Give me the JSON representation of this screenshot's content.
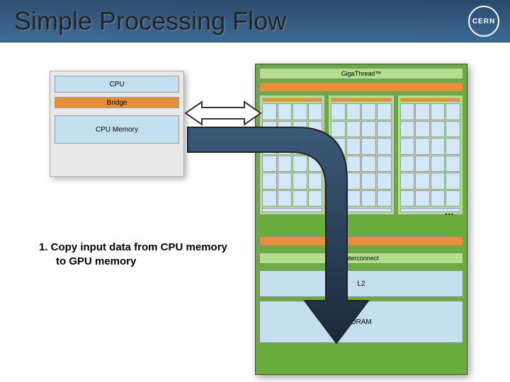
{
  "header": {
    "title": "Simple Processing Flow",
    "logo": "CERN"
  },
  "cpu": {
    "cpu_label": "CPU",
    "bridge_label": "Bridge",
    "mem_label": "CPU Memory"
  },
  "gpu": {
    "thread_label": "GigaThread™",
    "ellipsis": "...",
    "interconnect_label": "Interconnect",
    "l2_label": "L2",
    "dram_label": "DRAM"
  },
  "step": {
    "line1": "1.  Copy input data from CPU memory",
    "line2": "to GPU memory"
  }
}
